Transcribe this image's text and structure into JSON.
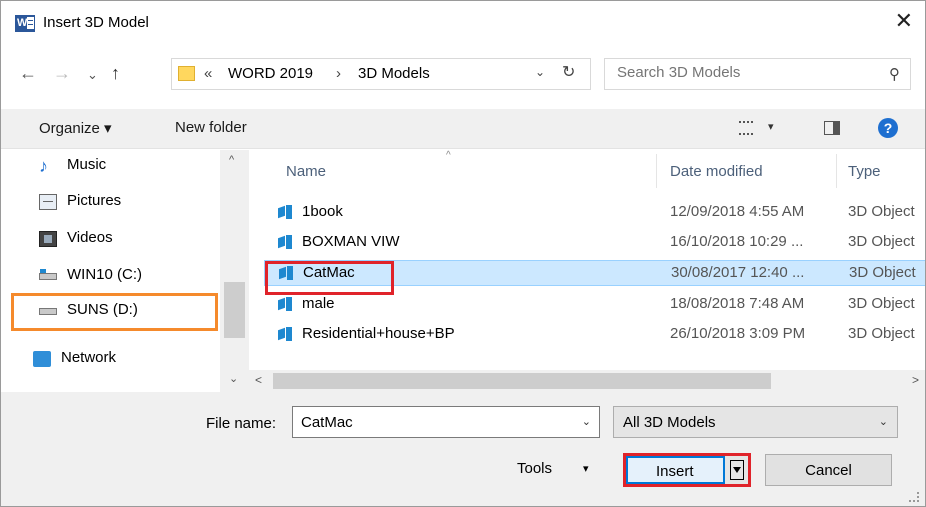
{
  "window": {
    "title": "Insert 3D Model",
    "app_icon": "word-icon",
    "close_glyph": "✕"
  },
  "navigation": {
    "back": "←",
    "forward": "→",
    "recent": "⌄",
    "up": "↑"
  },
  "address": {
    "overflow": "«",
    "crumbs": [
      "WORD 2019",
      "3D Models"
    ],
    "separator": "›",
    "dropdown": "⌄",
    "refresh": "↻"
  },
  "search": {
    "placeholder": "Search 3D Models",
    "icon": "⚲"
  },
  "toolbar": {
    "organize": "Organize ▾",
    "new_folder": "New folder",
    "view_dropdown": "▾",
    "help": "?"
  },
  "nav_pane": {
    "items": [
      {
        "label": "Music",
        "icon": "music-icon"
      },
      {
        "label": "Pictures",
        "icon": "pictures-icon"
      },
      {
        "label": "Videos",
        "icon": "videos-icon"
      },
      {
        "label": "WIN10 (C:)",
        "icon": "drive-icon"
      },
      {
        "label": "SUNS (D:)",
        "icon": "drive-icon"
      },
      {
        "label": "Network",
        "icon": "network-icon"
      }
    ],
    "scroll_up": "^",
    "scroll_down": "⌄"
  },
  "file_list": {
    "columns": [
      "Name",
      "Date modified",
      "Type"
    ],
    "sort_indicator": "^",
    "rows": [
      {
        "name": "1book",
        "date": "12/09/2018 4:55 AM",
        "type": "3D Object"
      },
      {
        "name": "BOXMAN VIW",
        "date": "16/10/2018 10:29 ...",
        "type": "3D Object"
      },
      {
        "name": "CatMac",
        "date": "30/08/2017 12:40 ...",
        "type": "3D Object"
      },
      {
        "name": "male",
        "date": "18/08/2018 7:48 AM",
        "type": "3D Object"
      },
      {
        "name": "Residential+house+BP",
        "date": "26/10/2018 3:09 PM",
        "type": "3D Object"
      }
    ],
    "selected_index": 2,
    "scroll_left": "<",
    "scroll_right": ">"
  },
  "bottom": {
    "file_name_label": "File name:",
    "file_name_value": "CatMac",
    "file_name_dropdown": "⌄",
    "filter_value": "All 3D Models",
    "filter_dropdown": "⌄",
    "tools_label": "Tools",
    "tools_dropdown": "▾",
    "insert_label": "Insert",
    "cancel_label": "Cancel"
  },
  "colors": {
    "selection": "#cce8ff",
    "highlight_orange": "#f58a2c",
    "highlight_red": "#e0232a",
    "accent_blue": "#1e88d0"
  }
}
